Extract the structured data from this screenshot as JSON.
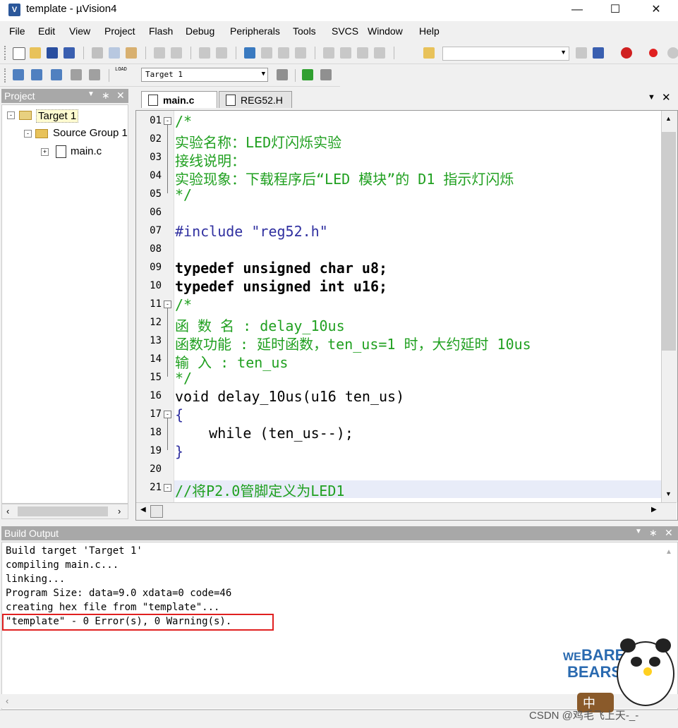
{
  "window": {
    "title": "template  - µVision4",
    "app_icon_label": "V"
  },
  "menu": [
    "File",
    "Edit",
    "View",
    "Project",
    "Flash",
    "Debug",
    "Peripherals",
    "Tools",
    "SVCS",
    "Window",
    "Help"
  ],
  "build_toolbar": {
    "target_combo_value": "Target 1",
    "load_label": "LOAD"
  },
  "project_pane": {
    "title": "Project",
    "tree": {
      "target": "Target 1",
      "group": "Source Group 1",
      "file": "main.c"
    }
  },
  "editor": {
    "tabs": [
      {
        "label": "main.c",
        "active": true
      },
      {
        "label": "REG52.H",
        "active": false
      }
    ],
    "line_numbers": [
      "01",
      "02",
      "03",
      "04",
      "05",
      "06",
      "07",
      "08",
      "09",
      "10",
      "11",
      "12",
      "13",
      "14",
      "15",
      "16",
      "17",
      "18",
      "19",
      "20",
      "21"
    ],
    "lines": [
      "/*",
      "实验名称：LED灯闪烁实验",
      "接线说明：",
      "实验现象：下载程序后“LED 模块”的 D1 指示灯闪烁",
      "*/",
      "",
      "#include \"reg52.h\"",
      "",
      "typedef unsigned char u8;",
      "typedef unsigned int u16;",
      "/*",
      "函 数 名 : delay_10us",
      "函数功能 : 延时函数，ten_us=1 时，大约延时 10us",
      "输 入 : ten_us",
      "*/",
      "void delay_10us(u16 ten_us)",
      "{",
      "    while (ten_us--);",
      "}",
      "",
      "//将P2.0管脚定义为LED1"
    ]
  },
  "build_output": {
    "title": "Build Output",
    "lines": [
      "Build target 'Target 1'",
      "compiling main.c...",
      "linking...",
      "Program Size: data=9.0 xdata=0 code=46",
      "creating hex file from \"template\"...",
      "\"template\" - 0 Error(s), 0 Warning(s)."
    ]
  },
  "watermark": "CSDN @鸡毛飞上天-_-",
  "sticker": {
    "line1": "WE",
    "line2": "BARE",
    "line3": "BEARS",
    "ime": "中"
  },
  "colors": {
    "comment": "#20a020",
    "pane_header": "#a8a8a8",
    "error_box": "#e02020",
    "string": "#800000"
  }
}
